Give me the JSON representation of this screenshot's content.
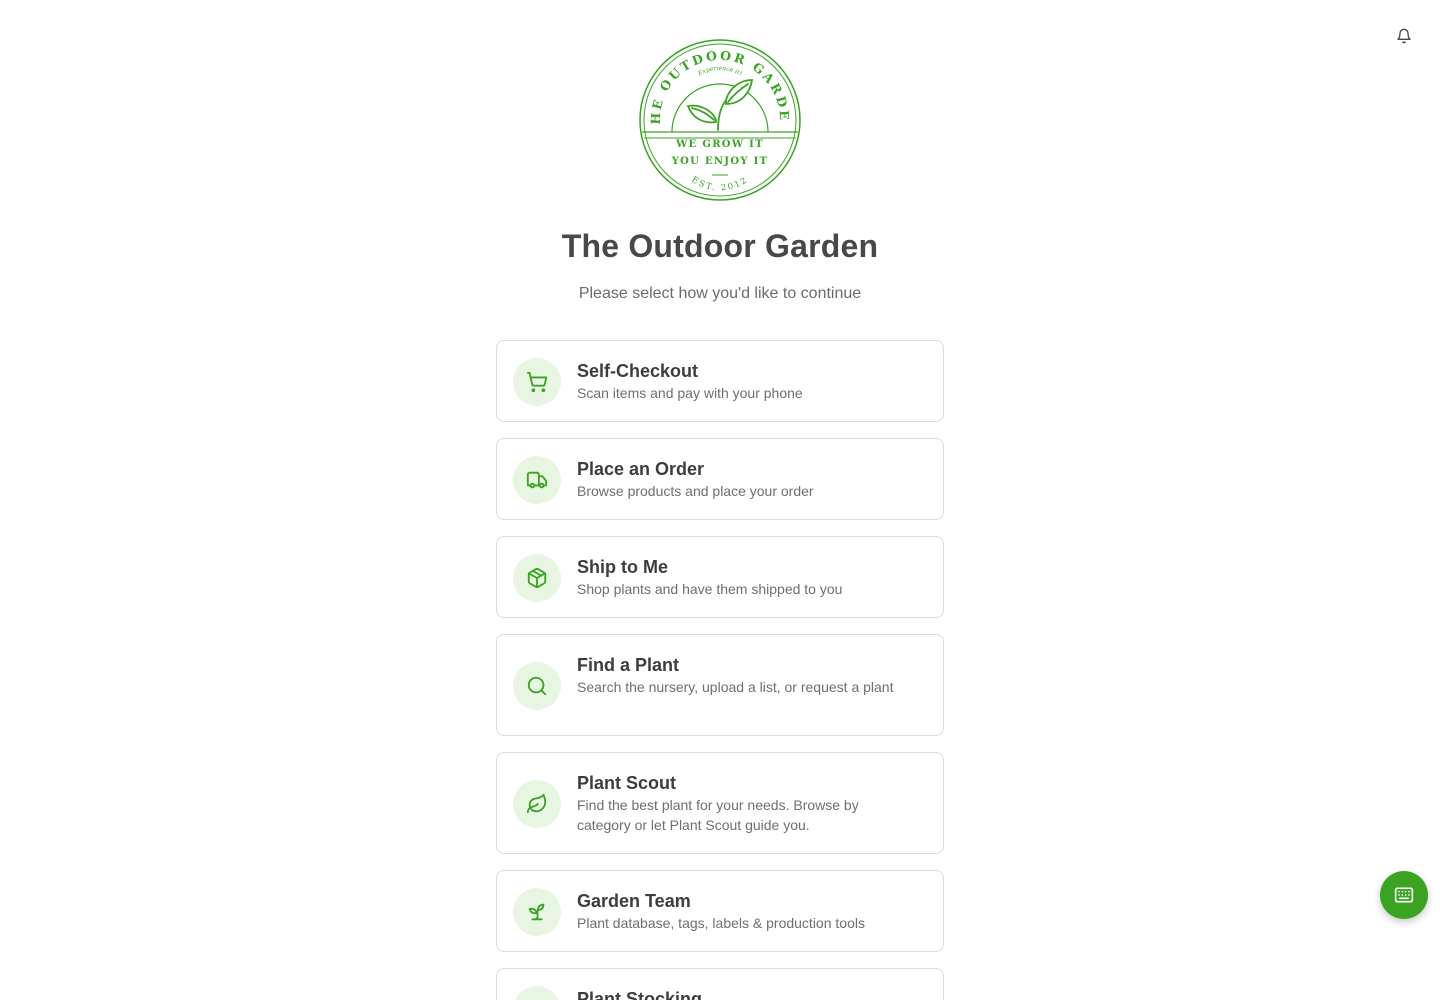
{
  "logo": {
    "ring_text": "THE OUTDOOR GARDEN",
    "tagline_small": "Experience it!",
    "line1": "WE GROW IT",
    "line2": "YOU ENJOY IT",
    "est": "EST. 2012",
    "color": "#3aa321"
  },
  "header": {
    "title": "The Outdoor Garden",
    "subtitle": "Please select how you'd like to continue"
  },
  "icons": {
    "notifications": "bell-icon",
    "keyboard": "keyboard-icon"
  },
  "colors": {
    "accent": "#3aa321",
    "icon_bg": "#e9f5e3"
  },
  "options": [
    {
      "title": "Self-Checkout",
      "description": "Scan items and pay with your phone",
      "icon": "cart-icon"
    },
    {
      "title": "Place an Order",
      "description": "Browse products and place your order",
      "icon": "truck-icon"
    },
    {
      "title": "Ship to Me",
      "description": "Shop plants and have them shipped to you",
      "icon": "package-icon"
    },
    {
      "title": "Find a Plant",
      "description": "Search the nursery, upload a list, or request a plant",
      "icon": "search-icon"
    },
    {
      "title": "Plant Scout",
      "description": "Find the best plant for your needs. Browse by category or let Plant Scout guide you.",
      "icon": "leaf-icon"
    },
    {
      "title": "Garden Team",
      "description": "Plant database, tags, labels & production tools",
      "icon": "sprout-icon"
    },
    {
      "title": "Plant Stocking",
      "description": "",
      "icon": "box-icon"
    }
  ]
}
